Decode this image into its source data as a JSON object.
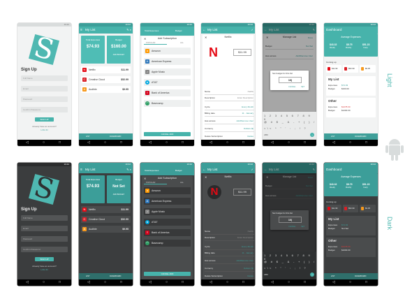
{
  "theme_labels": {
    "light": "Light",
    "dark": "Dark"
  },
  "status_time": "10:42",
  "signup": {
    "title": "Sign Up",
    "fields": [
      "Full Name",
      "Email",
      "Password",
      "Confirm Password"
    ],
    "button": "SIGN UP",
    "have_account": "Already have an account?",
    "login": "LOG IN"
  },
  "mylist": {
    "title": "My List",
    "total_label": "Total Expenses",
    "total_value": "$74.93",
    "budget_label": "Budget",
    "budget_value_light": "$160.00",
    "budget_value_dark": "Not Set",
    "add_label": "ADD BUDGET",
    "items": [
      {
        "name": "Netflix",
        "price": "$11.99",
        "letter": "N",
        "color": "#e50914"
      },
      {
        "name": "Creative Cloud",
        "price": "$52.99",
        "letter": "C",
        "color": "#da1f26"
      },
      {
        "name": "Audible",
        "price": "$9.95",
        "letter": "A",
        "color": "#f7991c"
      }
    ],
    "bottom_tabs": [
      "LIST",
      "DASHBOARD"
    ]
  },
  "add_sub": {
    "title": "Add Subscription",
    "tabs": [
      "POPULAR",
      "ALL"
    ],
    "top_tabs": [
      "Total Expenses",
      "Budget"
    ],
    "services": [
      {
        "name": "Amazon",
        "color": "#ff9900"
      },
      {
        "name": "American Express",
        "color": "#2e77bb"
      },
      {
        "name": "Apple Music",
        "color": "#888888"
      },
      {
        "name": "AT&T",
        "color": "#00a8e0"
      },
      {
        "name": "Bank of America",
        "color": "#d4001a"
      },
      {
        "name": "Basecamp",
        "color": "#2f9f65"
      }
    ],
    "button": "CANCEL ADD"
  },
  "detail": {
    "title": "Netflix",
    "price": "$11.99",
    "rows": [
      {
        "label": "Name",
        "value": "Netflix"
      },
      {
        "label": "Description",
        "value": "Enter Description"
      },
      {
        "label": "Cycle",
        "value": "Every Month"
      },
      {
        "label": "Billing date",
        "value": "11 · January"
      },
      {
        "label": "Has access",
        "value": "Add/Remove User"
      },
      {
        "label": "Currency",
        "value": "Dollars ($)"
      }
    ],
    "delete_label": "Delete Subscription",
    "delete_action": "Delete"
  },
  "manage": {
    "title": "Manage List",
    "action": "Done",
    "budget_label": "Budget",
    "budget_value": "Not Set",
    "has_access": "Has access",
    "has_access_value": "Add/Remove User",
    "dialog_title": "Set budget for this list",
    "dialog_value": "16|",
    "cancel": "CANCEL",
    "set": "SET",
    "key_rows": [
      "1 2 3 4 5 6 7 8 9 0",
      "@ # $ _ & - + ( ) /",
      "=\\< * \" ' : ; ! ?"
    ],
    "abc": "ABC"
  },
  "dashboard": {
    "title": "Dashboard",
    "avg_label": "Average Expenses",
    "avg_values": [
      "$43.32",
      "$8.75",
      "$51.23"
    ],
    "avg_periods": [
      "Weekly",
      "Monthly",
      "Yearly"
    ],
    "coming_up": "Coming up",
    "upcoming": [
      {
        "price": "$11.99",
        "color": "#e50914"
      },
      {
        "price": "$52.99",
        "color": "#da1f26"
      },
      {
        "price": "$9.95",
        "color": "#f7991c"
      }
    ],
    "lists": [
      {
        "name": "My List",
        "expenses": "$74.93",
        "budget": "$160.00",
        "dark_budget": "Not Set"
      },
      {
        "name": "Other",
        "expenses": "$1278.00",
        "budget": "$1200.00",
        "dark_budget": "$1000.00"
      }
    ],
    "expenses_label": "Expenses",
    "budget_label": "Budget"
  }
}
